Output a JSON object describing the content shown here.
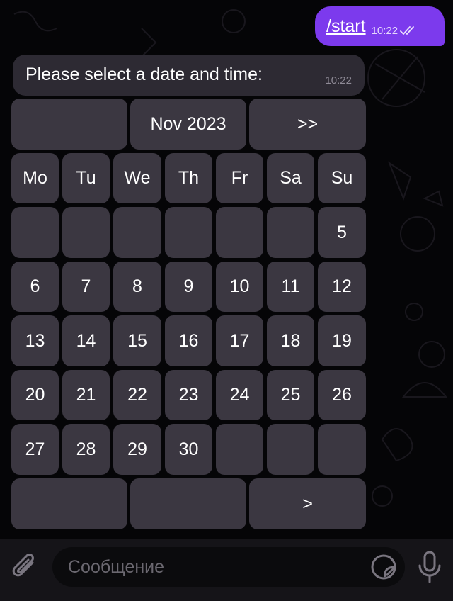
{
  "chat": {
    "outgoing": {
      "text": "/start",
      "time": "10:22"
    },
    "incoming": {
      "text": "Please select a date and time:",
      "time": "10:22"
    }
  },
  "calendar": {
    "month_label": "Nov 2023",
    "next_month_label": ">>",
    "weekdays": [
      "Mo",
      "Tu",
      "We",
      "Th",
      "Fr",
      "Sa",
      "Su"
    ],
    "weeks": [
      [
        "",
        "",
        "",
        "",
        "",
        "",
        "5"
      ],
      [
        "6",
        "7",
        "8",
        "9",
        "10",
        "11",
        "12"
      ],
      [
        "13",
        "14",
        "15",
        "16",
        "17",
        "18",
        "19"
      ],
      [
        "20",
        "21",
        "22",
        "23",
        "24",
        "25",
        "26"
      ],
      [
        "27",
        "28",
        "29",
        "30",
        "",
        "",
        ""
      ]
    ],
    "next_label": ">"
  },
  "composer": {
    "placeholder": "Сообщение"
  },
  "colors": {
    "accent": "#7c3aed",
    "button": "#3e3a44",
    "bubble": "#2d2a33",
    "background": "#050507"
  },
  "icons": [
    "paperclip-icon",
    "sticker-icon",
    "microphone-icon",
    "double-check-icon"
  ]
}
